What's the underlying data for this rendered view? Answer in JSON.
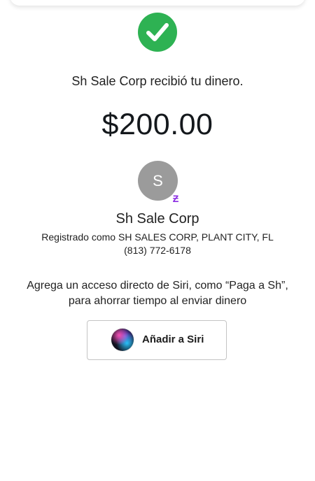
{
  "status": {
    "icon": "checkmark-circle-icon",
    "accent_color": "#2eb253",
    "message": "Sh Sale Corp recibió tu dinero."
  },
  "payment": {
    "amount": "$200.00"
  },
  "recipient": {
    "avatar_initial": "S",
    "avatar_color": "#9b9b9b",
    "badge_icon": "cashapp-badge-icon",
    "badge_glyph": "Ƶ",
    "badge_color": "#8a2be2",
    "name": "Sh Sale Corp",
    "registered": "Registrado como SH SALES CORP, PLANT CITY, FL",
    "phone": "(813) 772-6178"
  },
  "siri": {
    "prompt_line1": "Agrega un acceso directo de Siri, como “Paga a Sh”,",
    "prompt_line2": "para ahorrar tiempo al enviar dinero",
    "button_label": "Añadir a Siri",
    "button_icon": "siri-icon"
  }
}
